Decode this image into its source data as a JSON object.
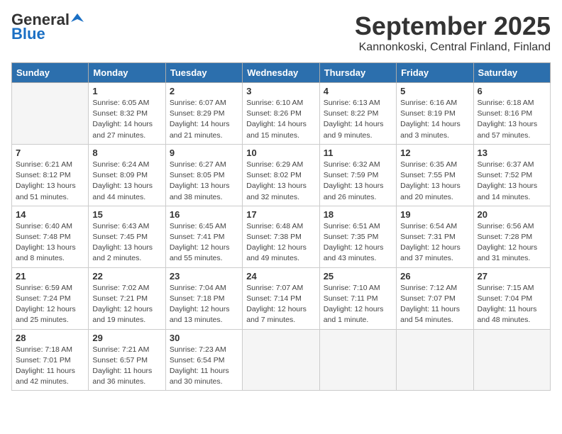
{
  "logo": {
    "general": "General",
    "blue": "Blue"
  },
  "title": "September 2025",
  "location": "Kannonkoski, Central Finland, Finland",
  "weekdays": [
    "Sunday",
    "Monday",
    "Tuesday",
    "Wednesday",
    "Thursday",
    "Friday",
    "Saturday"
  ],
  "weeks": [
    [
      {
        "day": "",
        "info": ""
      },
      {
        "day": "1",
        "info": "Sunrise: 6:05 AM\nSunset: 8:32 PM\nDaylight: 14 hours\nand 27 minutes."
      },
      {
        "day": "2",
        "info": "Sunrise: 6:07 AM\nSunset: 8:29 PM\nDaylight: 14 hours\nand 21 minutes."
      },
      {
        "day": "3",
        "info": "Sunrise: 6:10 AM\nSunset: 8:26 PM\nDaylight: 14 hours\nand 15 minutes."
      },
      {
        "day": "4",
        "info": "Sunrise: 6:13 AM\nSunset: 8:22 PM\nDaylight: 14 hours\nand 9 minutes."
      },
      {
        "day": "5",
        "info": "Sunrise: 6:16 AM\nSunset: 8:19 PM\nDaylight: 14 hours\nand 3 minutes."
      },
      {
        "day": "6",
        "info": "Sunrise: 6:18 AM\nSunset: 8:16 PM\nDaylight: 13 hours\nand 57 minutes."
      }
    ],
    [
      {
        "day": "7",
        "info": "Sunrise: 6:21 AM\nSunset: 8:12 PM\nDaylight: 13 hours\nand 51 minutes."
      },
      {
        "day": "8",
        "info": "Sunrise: 6:24 AM\nSunset: 8:09 PM\nDaylight: 13 hours\nand 44 minutes."
      },
      {
        "day": "9",
        "info": "Sunrise: 6:27 AM\nSunset: 8:05 PM\nDaylight: 13 hours\nand 38 minutes."
      },
      {
        "day": "10",
        "info": "Sunrise: 6:29 AM\nSunset: 8:02 PM\nDaylight: 13 hours\nand 32 minutes."
      },
      {
        "day": "11",
        "info": "Sunrise: 6:32 AM\nSunset: 7:59 PM\nDaylight: 13 hours\nand 26 minutes."
      },
      {
        "day": "12",
        "info": "Sunrise: 6:35 AM\nSunset: 7:55 PM\nDaylight: 13 hours\nand 20 minutes."
      },
      {
        "day": "13",
        "info": "Sunrise: 6:37 AM\nSunset: 7:52 PM\nDaylight: 13 hours\nand 14 minutes."
      }
    ],
    [
      {
        "day": "14",
        "info": "Sunrise: 6:40 AM\nSunset: 7:48 PM\nDaylight: 13 hours\nand 8 minutes."
      },
      {
        "day": "15",
        "info": "Sunrise: 6:43 AM\nSunset: 7:45 PM\nDaylight: 13 hours\nand 2 minutes."
      },
      {
        "day": "16",
        "info": "Sunrise: 6:45 AM\nSunset: 7:41 PM\nDaylight: 12 hours\nand 55 minutes."
      },
      {
        "day": "17",
        "info": "Sunrise: 6:48 AM\nSunset: 7:38 PM\nDaylight: 12 hours\nand 49 minutes."
      },
      {
        "day": "18",
        "info": "Sunrise: 6:51 AM\nSunset: 7:35 PM\nDaylight: 12 hours\nand 43 minutes."
      },
      {
        "day": "19",
        "info": "Sunrise: 6:54 AM\nSunset: 7:31 PM\nDaylight: 12 hours\nand 37 minutes."
      },
      {
        "day": "20",
        "info": "Sunrise: 6:56 AM\nSunset: 7:28 PM\nDaylight: 12 hours\nand 31 minutes."
      }
    ],
    [
      {
        "day": "21",
        "info": "Sunrise: 6:59 AM\nSunset: 7:24 PM\nDaylight: 12 hours\nand 25 minutes."
      },
      {
        "day": "22",
        "info": "Sunrise: 7:02 AM\nSunset: 7:21 PM\nDaylight: 12 hours\nand 19 minutes."
      },
      {
        "day": "23",
        "info": "Sunrise: 7:04 AM\nSunset: 7:18 PM\nDaylight: 12 hours\nand 13 minutes."
      },
      {
        "day": "24",
        "info": "Sunrise: 7:07 AM\nSunset: 7:14 PM\nDaylight: 12 hours\nand 7 minutes."
      },
      {
        "day": "25",
        "info": "Sunrise: 7:10 AM\nSunset: 7:11 PM\nDaylight: 12 hours\nand 1 minute."
      },
      {
        "day": "26",
        "info": "Sunrise: 7:12 AM\nSunset: 7:07 PM\nDaylight: 11 hours\nand 54 minutes."
      },
      {
        "day": "27",
        "info": "Sunrise: 7:15 AM\nSunset: 7:04 PM\nDaylight: 11 hours\nand 48 minutes."
      }
    ],
    [
      {
        "day": "28",
        "info": "Sunrise: 7:18 AM\nSunset: 7:01 PM\nDaylight: 11 hours\nand 42 minutes."
      },
      {
        "day": "29",
        "info": "Sunrise: 7:21 AM\nSunset: 6:57 PM\nDaylight: 11 hours\nand 36 minutes."
      },
      {
        "day": "30",
        "info": "Sunrise: 7:23 AM\nSunset: 6:54 PM\nDaylight: 11 hours\nand 30 minutes."
      },
      {
        "day": "",
        "info": ""
      },
      {
        "day": "",
        "info": ""
      },
      {
        "day": "",
        "info": ""
      },
      {
        "day": "",
        "info": ""
      }
    ]
  ]
}
